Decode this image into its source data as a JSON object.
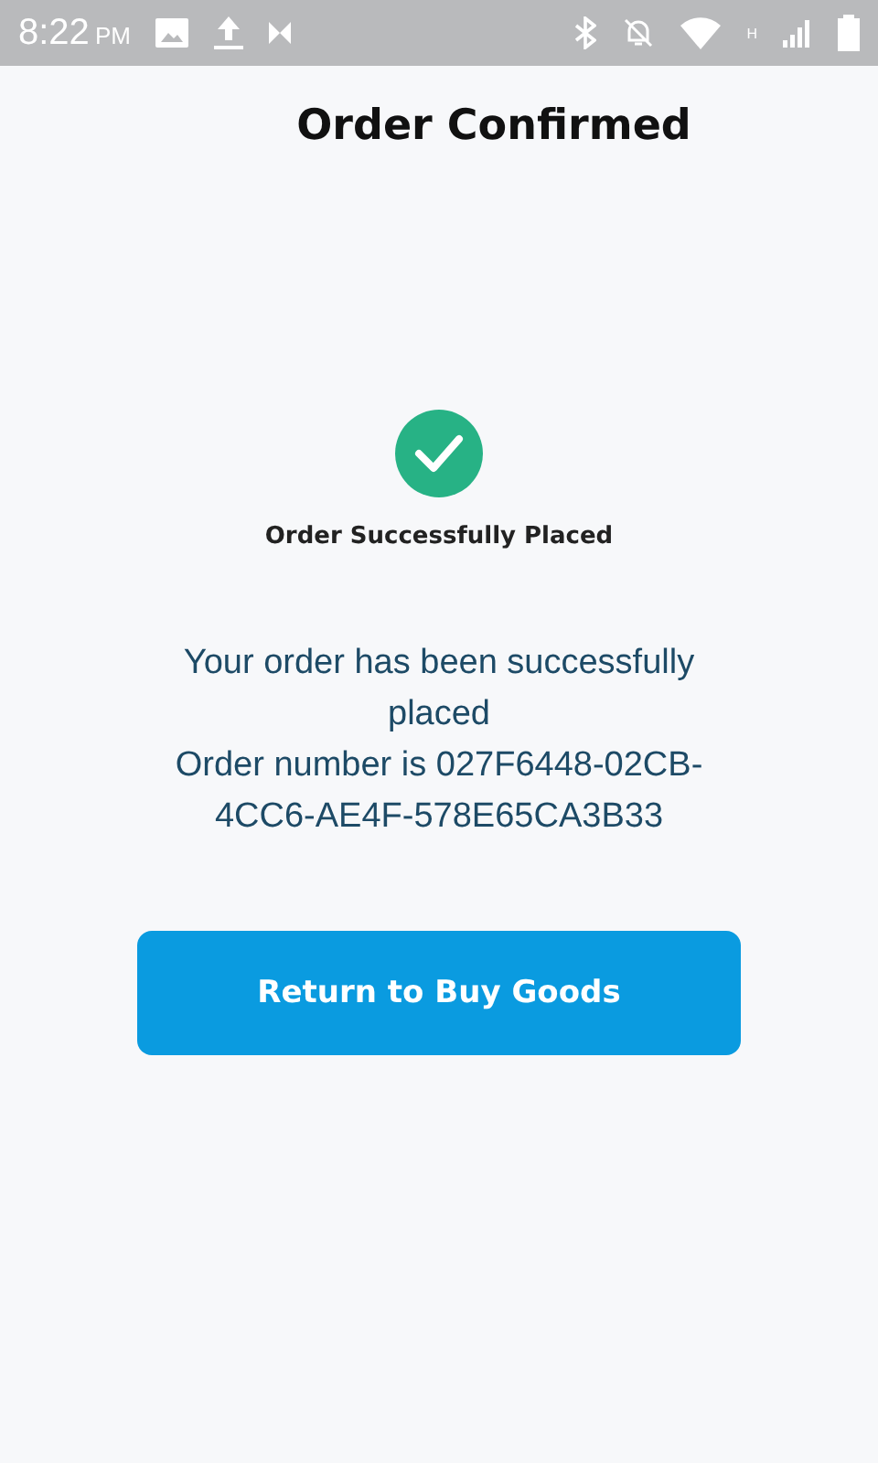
{
  "status_bar": {
    "time": "8:22",
    "period": "PM",
    "network_type": "H"
  },
  "header": {
    "title": "Order Confirmed"
  },
  "confirmation": {
    "heading": "Order Successfully Placed",
    "message": "Your order has been successfully placed",
    "order_line": "Order number is 027F6448-02CB-4CC6-AE4F-578E65CA3B33"
  },
  "buttons": [
    {
      "label": "Return to Buy Goods",
      "kind": "primary"
    }
  ]
}
